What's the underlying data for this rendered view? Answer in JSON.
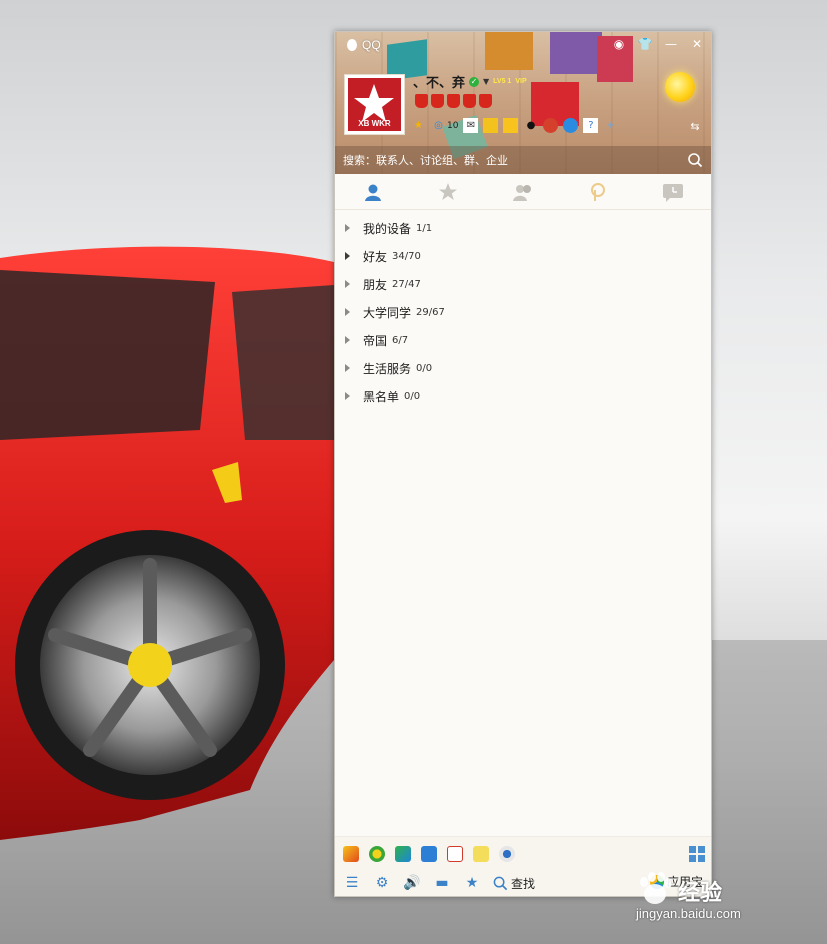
{
  "window": {
    "title": "QQ"
  },
  "profile": {
    "nickname": "、不、弃",
    "level_label": "LV5 1",
    "vip_label": "VIP",
    "avatar_text": "XB WKR",
    "qzone_count": "10"
  },
  "search": {
    "placeholder": "搜索：联系人、讨论组、群、企业"
  },
  "tabs": [
    {
      "icon": "contacts-icon"
    },
    {
      "icon": "favorites-star-icon"
    },
    {
      "icon": "groups-icon"
    },
    {
      "icon": "qzone-icon"
    },
    {
      "icon": "recent-chat-icon"
    }
  ],
  "groups": [
    {
      "name": "我的设备",
      "count": "1/1"
    },
    {
      "name": "好友",
      "count": "34/70"
    },
    {
      "name": "朋友",
      "count": "27/47"
    },
    {
      "name": "大学同学",
      "count": "29/67"
    },
    {
      "name": "帝国",
      "count": "6/7"
    },
    {
      "name": "生活服务",
      "count": "0/0"
    },
    {
      "name": "黑名单",
      "count": "0/0"
    }
  ],
  "bottom": {
    "find_label": "查找",
    "appbox_label": "应用宝"
  },
  "watermark": {
    "brand": "经验",
    "url": "jingyan.baidu.com"
  },
  "colors": {
    "accent": "#3c82c8",
    "car_red": "#d71d1a",
    "search_bar": "#7a5a44"
  }
}
